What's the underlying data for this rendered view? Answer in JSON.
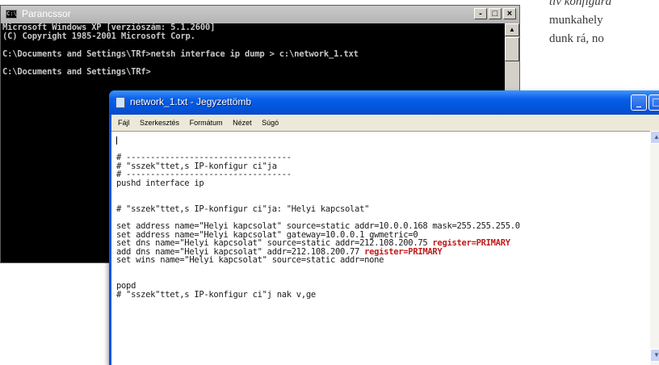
{
  "magazine": {
    "line1": "tív konfigurá",
    "line2": "munkahely",
    "line3": "dunk rá, no"
  },
  "console": {
    "title": "Parancssor",
    "icon": "console-icon",
    "buttons": [
      "-",
      "□",
      "×"
    ],
    "lines": [
      "Microsoft Windows XP [verziószám: 5.1.2600]",
      "(C) Copyright 1985-2001 Microsoft Corp.",
      "",
      "C:\\Documents and Settings\\TRf>netsh interface ip dump > c:\\network_1.txt",
      "",
      "C:\\Documents and Settings\\TRf>"
    ]
  },
  "notepad": {
    "title": "network_1.txt - Jegyzettömb",
    "icon": "notepad-icon",
    "menu": [
      "Fájl",
      "Szerkesztés",
      "Formátum",
      "Nézet",
      "Súgó"
    ],
    "lines": [
      "",
      "",
      "# ----------------------------------",
      "# \"sszek\"ttet,s IP-konfigur ci\"ja",
      "# ----------------------------------",
      "pushd interface ip",
      "",
      "",
      "# \"sszek\"ttet,s IP-konfigur ci\"ja: \"Helyi kapcsolat\"",
      "",
      "set address name=\"Helyi kapcsolat\" source=static addr=10.0.0.168 mask=255.255.255.0",
      "set address name=\"Helyi kapcsolat\" gateway=10.0.0.1 gwmetric=0",
      "set dns name=\"Helyi kapcsolat\" source=static addr=212.108.200.75 ",
      "add dns name=\"Helyi kapcsolat\" addr=212.108.200.77 ",
      "set wins name=\"Helyi kapcsolat\" source=static addr=none",
      "",
      "",
      "popd",
      "# \"sszek\"ttet,s IP-konfigur ci\"j nak v,ge"
    ],
    "highlight": "register=PRIMARY"
  }
}
